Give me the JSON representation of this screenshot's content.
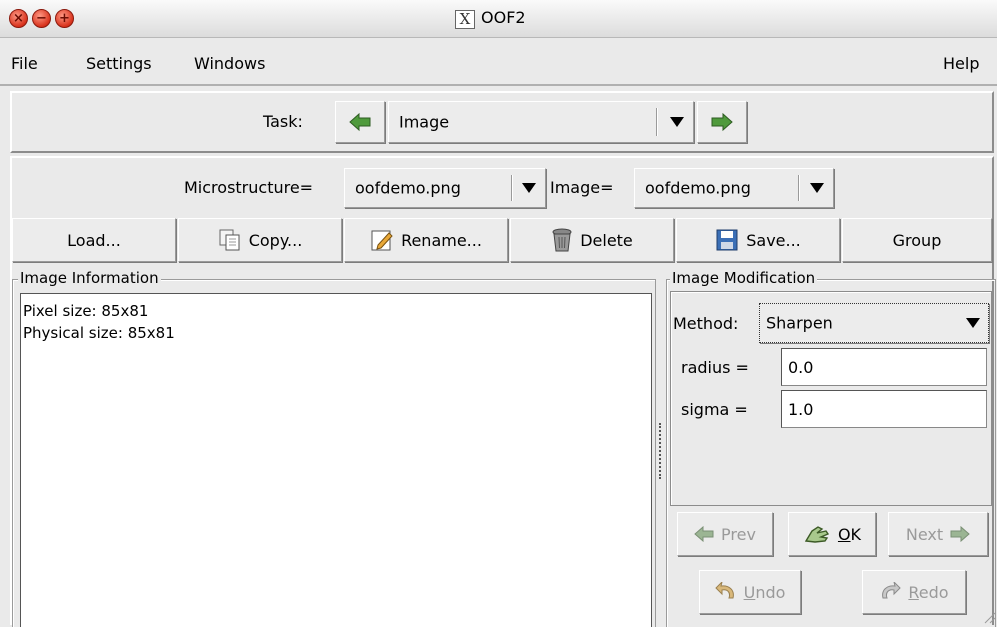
{
  "window": {
    "title": "OOF2",
    "x_glyph": "X"
  },
  "menubar": {
    "file": "File",
    "settings": "Settings",
    "windows": "Windows",
    "help": "Help"
  },
  "task": {
    "label": "Task:",
    "value": "Image"
  },
  "selector": {
    "microstructure_label": "Microstructure=",
    "microstructure_value": "oofdemo.png",
    "image_label": "Image=",
    "image_value": "oofdemo.png"
  },
  "buttons": {
    "load": "Load...",
    "copy": "Copy...",
    "rename": "Rename...",
    "delete": "Delete",
    "save": "Save...",
    "group": "Group"
  },
  "info": {
    "title": "Image Information",
    "pixel_size": "Pixel size: 85x81",
    "physical_size": "Physical size: 85x81"
  },
  "modification": {
    "title": "Image Modification",
    "method_label": "Method:",
    "method_value": "Sharpen",
    "radius_label": "radius =",
    "radius_value": "0.0",
    "sigma_label": "sigma =",
    "sigma_value": "1.0",
    "prev": "Prev",
    "ok_underlined": "O",
    "ok_rest": "K",
    "next": "Next",
    "undo_underlined": "U",
    "undo_rest": "ndo",
    "redo_underlined": "R",
    "redo_rest": "edo"
  },
  "colors": {
    "arrow_green": "#4f9a3c",
    "close_red": "#d8321c",
    "window_bg": "#eaeaea"
  }
}
